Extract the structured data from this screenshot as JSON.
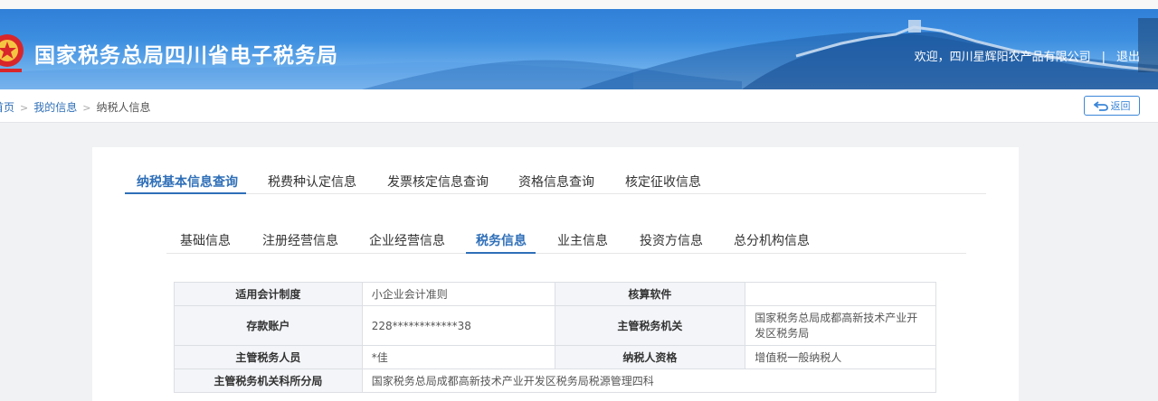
{
  "header": {
    "title": "国家税务总局四川省电子税务局",
    "welcome": "欢迎，四川星辉阳农产品有限公司",
    "separator": "|",
    "logout": "退出"
  },
  "breadcrumb": {
    "home": "首页",
    "my_info": "我的信息",
    "current": "纳税人信息",
    "back": "返回"
  },
  "main_tabs": [
    {
      "label": "纳税基本信息查询",
      "active": true
    },
    {
      "label": "税费种认定信息",
      "active": false
    },
    {
      "label": "发票核定信息查询",
      "active": false
    },
    {
      "label": "资格信息查询",
      "active": false
    },
    {
      "label": "核定征收信息",
      "active": false
    }
  ],
  "sub_tabs": [
    {
      "label": "基础信息",
      "active": false
    },
    {
      "label": "注册经营信息",
      "active": false
    },
    {
      "label": "企业经营信息",
      "active": false
    },
    {
      "label": "税务信息",
      "active": true
    },
    {
      "label": "业主信息",
      "active": false
    },
    {
      "label": "投资方信息",
      "active": false
    },
    {
      "label": "总分机构信息",
      "active": false
    }
  ],
  "tax_info": {
    "accounting_system_label": "适用会计制度",
    "accounting_system_value": "小企业会计准则",
    "accounting_software_label": "核算软件",
    "accounting_software_value": "",
    "deposit_account_label": "存款账户",
    "deposit_account_value": "228************38",
    "tax_authority_label": "主管税务机关",
    "tax_authority_value": "国家税务总局成都高新技术产业开发区税务局",
    "tax_officer_label": "主管税务人员",
    "tax_officer_value": "*佳",
    "taxpayer_qualification_label": "纳税人资格",
    "taxpayer_qualification_value": "增值税一般纳税人",
    "branch_label": "主管税务机关科所分局",
    "branch_value": "国家税务总局成都高新技术产业开发区税务局税源管理四科"
  },
  "colors": {
    "header_blue": "#2c7bd6",
    "accent": "#2f6fb8",
    "label_bg": "#f3f5f8"
  }
}
